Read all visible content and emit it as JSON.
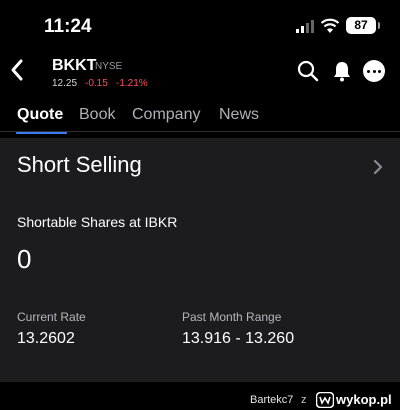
{
  "status_bar": {
    "time": "11:24",
    "battery": "87"
  },
  "header": {
    "symbol": "BKKT",
    "exchange": "NYSE",
    "price": "12.25",
    "change": "-0.15",
    "change_pct": "-1.21%"
  },
  "tabs": [
    {
      "label": "Quote"
    },
    {
      "label": "Book"
    },
    {
      "label": "Company"
    },
    {
      "label": "News"
    }
  ],
  "section": {
    "title": "Short Selling",
    "shortable_label": "Shortable Shares at IBKR",
    "shortable_value": "0",
    "current_rate_label": "Current Rate",
    "current_rate_value": "13.2602",
    "past_month_label": "Past Month Range",
    "past_month_value": "13.916 - 13.260"
  },
  "footer": {
    "user": "Bartekc7",
    "separator": "z",
    "site": "wykop.pl"
  },
  "colors": {
    "accent": "#3b7bf6",
    "negative": "#ff4d58",
    "card": "#1c1c1f"
  }
}
